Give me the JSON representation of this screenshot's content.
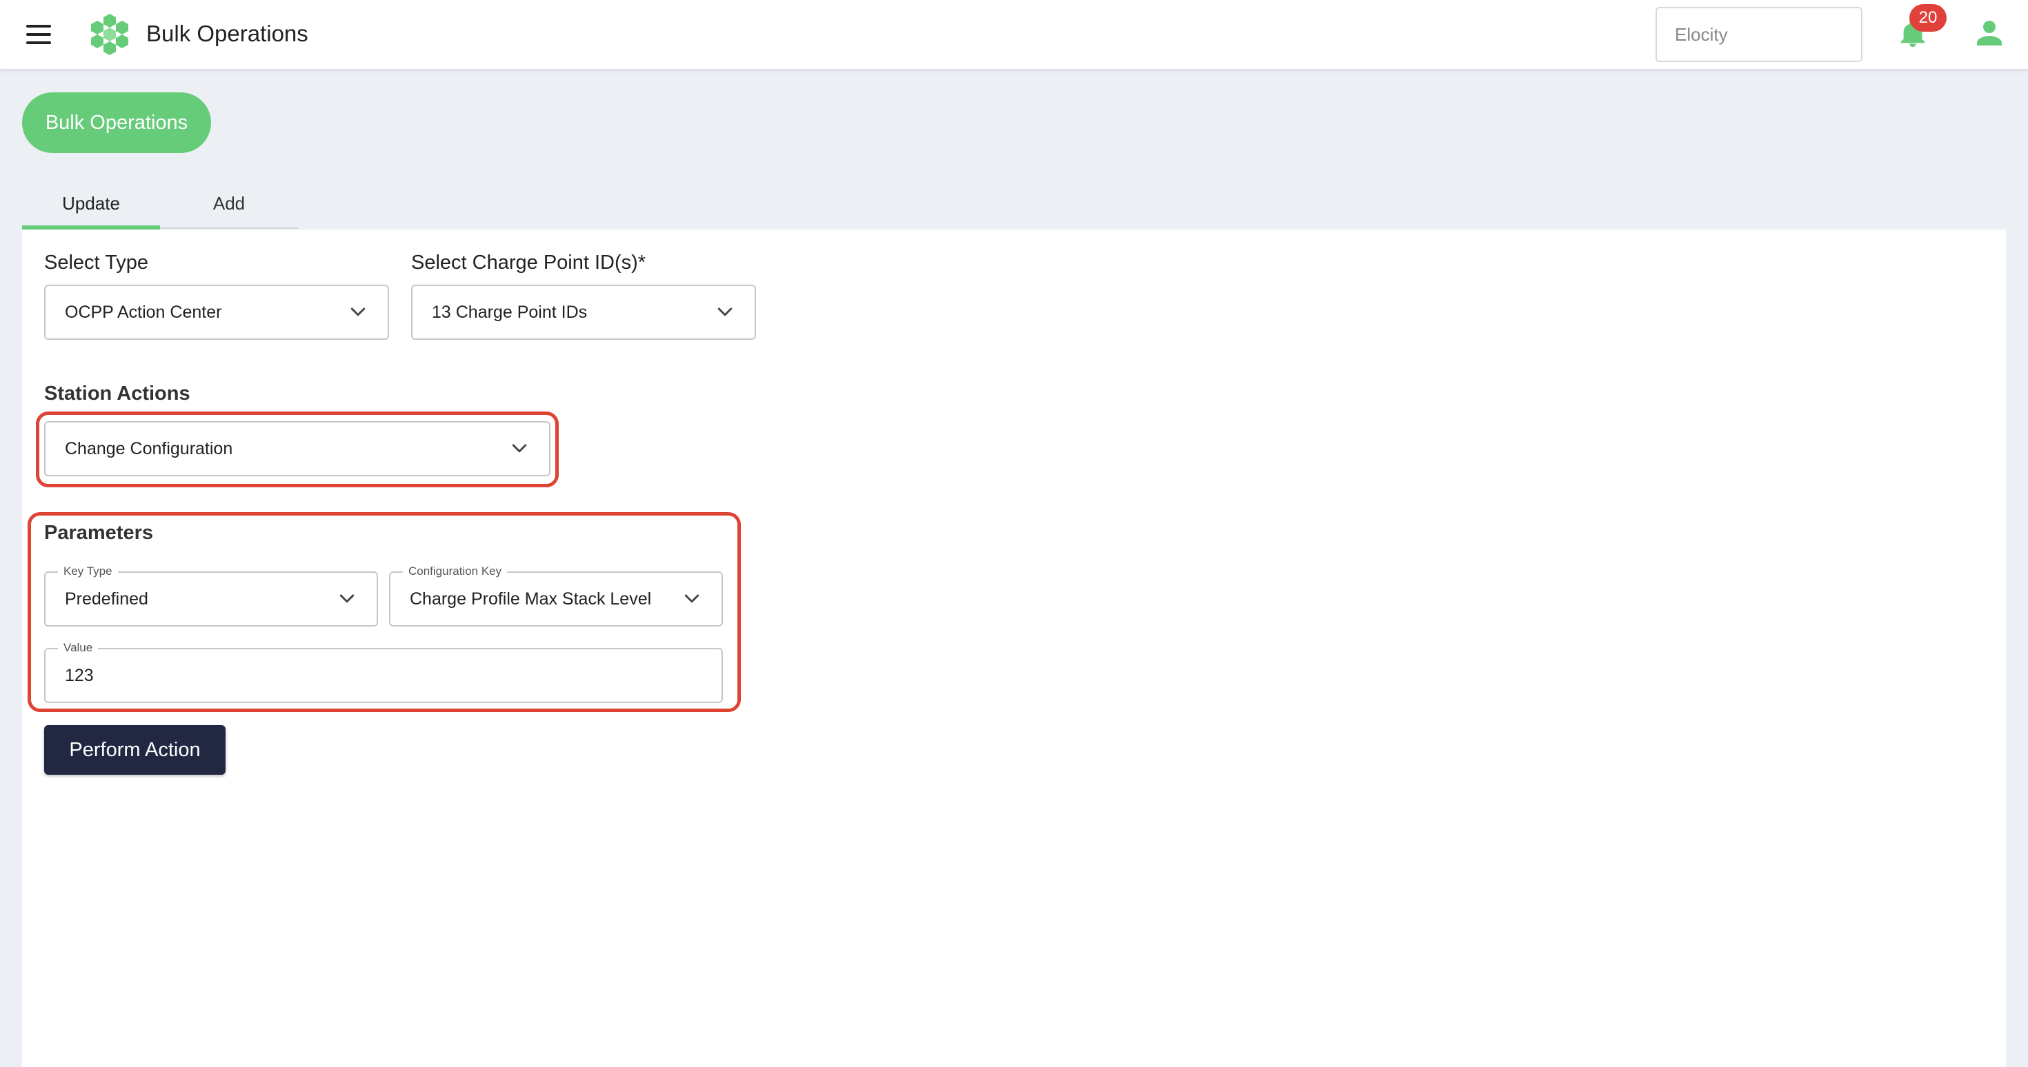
{
  "header": {
    "title": "Bulk Operations",
    "org_placeholder": "Elocity",
    "notification_count": "20",
    "logo_icon": "hexagon-cluster-logo",
    "menu_icon": "hamburger-menu-icon",
    "bell_icon": "bell-icon",
    "user_icon": "user-icon"
  },
  "page": {
    "hero_label": "Bulk Operations",
    "tabs": [
      {
        "label": "Update",
        "active": true
      },
      {
        "label": "Add",
        "active": false
      }
    ]
  },
  "form": {
    "select_type": {
      "label": "Select Type",
      "value": "OCPP Action Center"
    },
    "charge_points": {
      "label": "Select Charge Point ID(s)*",
      "value": "13 Charge Point IDs"
    },
    "station_actions": {
      "label": "Station Actions",
      "value": "Change Configuration"
    },
    "parameters": {
      "title": "Parameters",
      "key_type": {
        "label": "Key Type",
        "value": "Predefined"
      },
      "config_key": {
        "label": "Configuration Key",
        "value": "Charge Profile Max Stack Level"
      },
      "value": {
        "label": "Value",
        "value": "123"
      }
    },
    "submit_label": "Perform Action"
  },
  "colors": {
    "accent_green": "#66cc7a",
    "highlight_red": "#dd4433",
    "button_dark": "#232842",
    "badge_red": "#e0413a",
    "page_bg": "#eceff4"
  }
}
